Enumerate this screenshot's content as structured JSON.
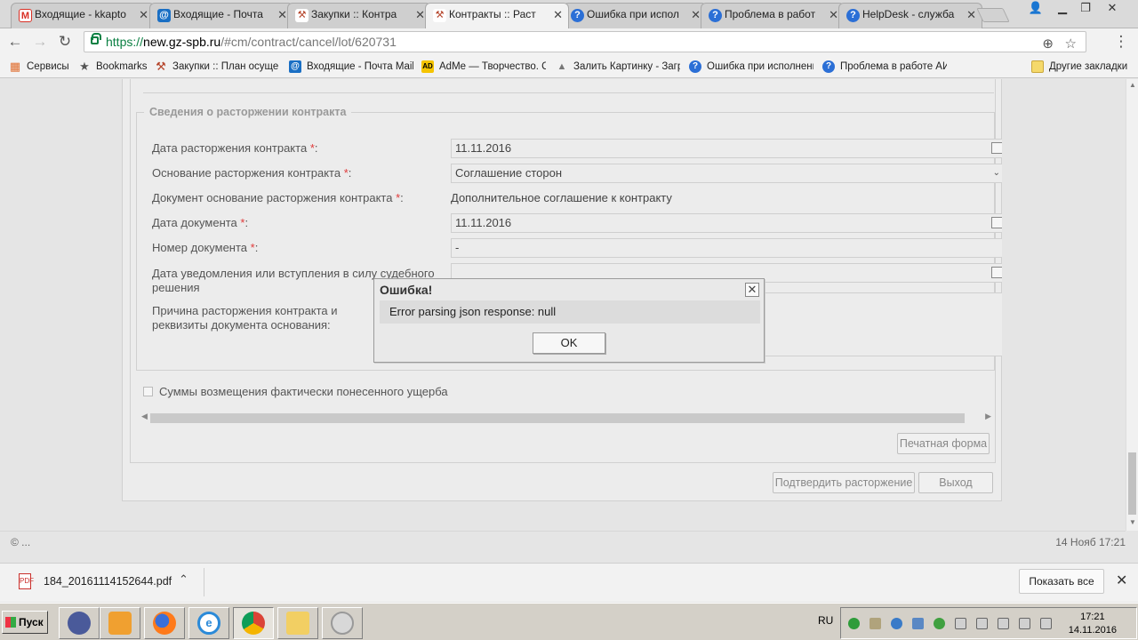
{
  "browser": {
    "tabs": [
      {
        "title": "Входящие - kkapto",
        "icon": "gmail-icon",
        "icon_char": "M",
        "icon_color": "#d93025",
        "active": false
      },
      {
        "title": "Входящие - Почта",
        "icon": "mail-ru-icon",
        "icon_char": "@",
        "icon_color": "#1a6fc4",
        "active": false
      },
      {
        "title": "Закупки :: Контра",
        "icon": "hammer-icon",
        "icon_char": "⚒",
        "icon_color": "#b5452b",
        "active": false
      },
      {
        "title": "Контракты :: Раст",
        "icon": "hammer-icon",
        "icon_char": "⚒",
        "icon_color": "#b5452b",
        "active": true
      },
      {
        "title": "Ошибка при испол",
        "icon": "helpdesk-icon",
        "icon_char": "?",
        "icon_color": "#2b6fd6",
        "active": false
      },
      {
        "title": "Проблема в работ",
        "icon": "helpdesk-icon",
        "icon_char": "?",
        "icon_color": "#2b6fd6",
        "active": false
      },
      {
        "title": "HelpDesk - служба",
        "icon": "helpdesk-icon",
        "icon_char": "?",
        "icon_color": "#2b6fd6",
        "active": false
      }
    ],
    "url": {
      "scheme": "https://",
      "host": "new.gz-spb.ru",
      "path": "/#cm/contract/cancel/lot/620731"
    },
    "bookmarks": [
      {
        "label": "Сервисы",
        "icon": "apps-grid-icon",
        "icon_char": "▦",
        "color": "#e06c2c"
      },
      {
        "label": "Bookmarks",
        "icon": "star-icon",
        "icon_char": "★",
        "color": "#555555"
      },
      {
        "label": "Закупки :: План осуще",
        "icon": "hammer-icon",
        "icon_char": "⚒",
        "color": "#b5452b"
      },
      {
        "label": "Входящие - Почта Mail",
        "icon": "mail-ru-icon",
        "icon_char": "@",
        "color": "#1a6fc4"
      },
      {
        "label": "AdMe — Творчество. С",
        "icon": "adme-icon",
        "icon_char": "AD",
        "color": "#1d1d1d"
      },
      {
        "label": "Залить Картинку - Загр",
        "icon": "picture-icon",
        "icon_char": "▲",
        "color": "#777777"
      },
      {
        "label": "Ошибка при исполнени",
        "icon": "helpdesk-icon",
        "icon_char": "?",
        "color": "#2b6fd6"
      },
      {
        "label": "Проблема в работе АИ",
        "icon": "helpdesk-icon",
        "icon_char": "?",
        "color": "#2b6fd6"
      }
    ],
    "other_bookmarks": "Другие закладки"
  },
  "form": {
    "section_title": "Сведения о расторжении контракта",
    "fields": {
      "termination_date": {
        "label": "Дата расторжения контракта",
        "value": "11.11.2016"
      },
      "termination_basis": {
        "label": "Основание расторжения контракта",
        "value": "Соглашение сторон"
      },
      "basis_document": {
        "label": "Документ основание расторжения контракта",
        "value": "Дополнительное соглашение к контракту"
      },
      "document_date": {
        "label": "Дата документа",
        "value": "11.11.2016"
      },
      "document_number": {
        "label": "Номер документа",
        "value": "-"
      },
      "notice_date": {
        "label": "Дата уведомления или вступления в силу судебного решения",
        "value": ""
      },
      "reason": {
        "label": "Причина расторжения контракта и реквизиты документа основания:",
        "value": ""
      }
    },
    "required_mark": "*",
    "label_suffix": ":",
    "damages_checkbox_label": "Суммы возмещения фактически понесенного ущерба",
    "print_button": "Печатная форма",
    "confirm_button": "Подтвердить расторжение",
    "exit_button": "Выход"
  },
  "footer": {
    "left": "© ...",
    "right": "14 Нояб 17:21"
  },
  "dialog": {
    "title": "Ошибка!",
    "message": "Error parsing json response: null",
    "ok_label": "OK"
  },
  "download_shelf": {
    "file_name": "184_20161114152644.pdf",
    "show_all": "Показать все"
  },
  "taskbar": {
    "start_label": "Пуск",
    "language": "RU",
    "time": "17:21",
    "date": "14.11.2016",
    "apps": [
      "acrobat-icon",
      "media-player-icon",
      "firefox-icon",
      "ie-icon",
      "chrome-icon",
      "explorer-folder-icon",
      "paint-icon"
    ]
  }
}
